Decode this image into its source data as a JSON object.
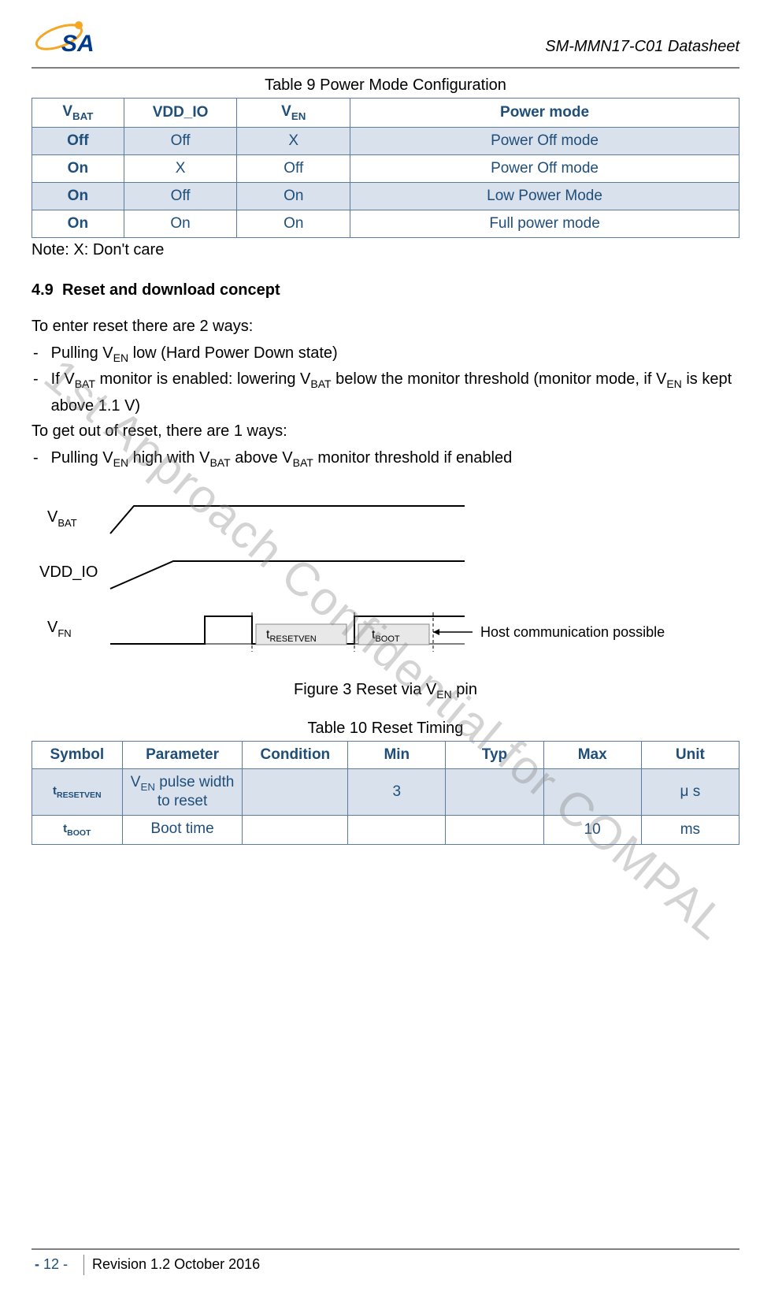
{
  "header": {
    "doc_title": "SM-MMN17-C01 Datasheet",
    "logo_text": "SA"
  },
  "watermark": "1st Approach Confidential for COMPAL",
  "table9": {
    "caption": "Table 9 Power Mode Configuration",
    "headers": {
      "c1": "V",
      "c1sub": "BAT",
      "c2": "VDD_IO",
      "c3": "V",
      "c3sub": "EN",
      "c4": "Power mode"
    },
    "rows": [
      {
        "c1": "Off",
        "c2": "Off",
        "c3": "X",
        "c4": "Power Off mode",
        "alt": true
      },
      {
        "c1": "On",
        "c2": "X",
        "c3": "Off",
        "c4": "Power Off mode",
        "alt": false
      },
      {
        "c1": "On",
        "c2": "Off",
        "c3": "On",
        "c4": "Low Power Mode",
        "alt": true
      },
      {
        "c1": "On",
        "c2": "On",
        "c3": "On",
        "c4": "Full power mode",
        "alt": false
      }
    ],
    "row0_bold": true
  },
  "note": "Note: X: Don't care",
  "section": {
    "number": "4.9",
    "title": "Reset and download concept"
  },
  "body": {
    "p1": "To enter reset there are 2 ways:",
    "b1_pre": "Pulling V",
    "b1_sub": "EN",
    "b1_post": " low (Hard Power Down state)",
    "b2_a": "If V",
    "b2_asub": "BAT",
    "b2_b": " monitor is enabled: lowering V",
    "b2_bsub": "BAT",
    "b2_c": " below the monitor threshold (monitor mode, if V",
    "b2_csub": "EN",
    "b2_d": " is kept above 1.1 V)",
    "p2": "To get out of reset, there are 1 ways:",
    "b3_a": "Pulling V",
    "b3_asub": "EN",
    "b3_b": " high with V",
    "b3_bsub": "BAT",
    "b3_c": " above V",
    "b3_csub": "BAT",
    "b3_d": " monitor threshold if enabled"
  },
  "figure": {
    "caption_pre": "Figure 3 Reset via V",
    "caption_sub": "EN",
    "caption_post": " pin",
    "labels": {
      "vbat": "V",
      "vbat_sub": "BAT",
      "vddio": "VDD_IO",
      "vfn": "V",
      "vfn_sub": "FN",
      "tresetven": "t",
      "tresetven_sub": "RESETVEN",
      "tboot": "t",
      "tboot_sub": "BOOT",
      "host": "Host communication possible"
    }
  },
  "table10": {
    "caption": "Table 10 Reset Timing",
    "headers": {
      "c1": "Symbol",
      "c2": "Parameter",
      "c3": "Condition",
      "c4": "Min",
      "c5": "Typ",
      "c6": "Max",
      "c7": "Unit"
    },
    "rows": [
      {
        "sym": "t",
        "symsub": "RESETVEN",
        "param_pre": "V",
        "param_sub": "EN",
        "param_post": " pulse width to reset",
        "cond": "",
        "min": "3",
        "typ": "",
        "max": "",
        "unit": "μ s",
        "alt": true
      },
      {
        "sym": "t",
        "symsub": "BOOT",
        "param_pre": "",
        "param_sub": "",
        "param_post": "Boot time",
        "cond": "",
        "min": "",
        "typ": "",
        "max": "10",
        "unit": "ms",
        "alt": false
      }
    ]
  },
  "footer": {
    "page_prefix": "- ",
    "page_num": "12",
    "page_suffix": " -",
    "revision": "Revision 1.2 October 2016"
  }
}
